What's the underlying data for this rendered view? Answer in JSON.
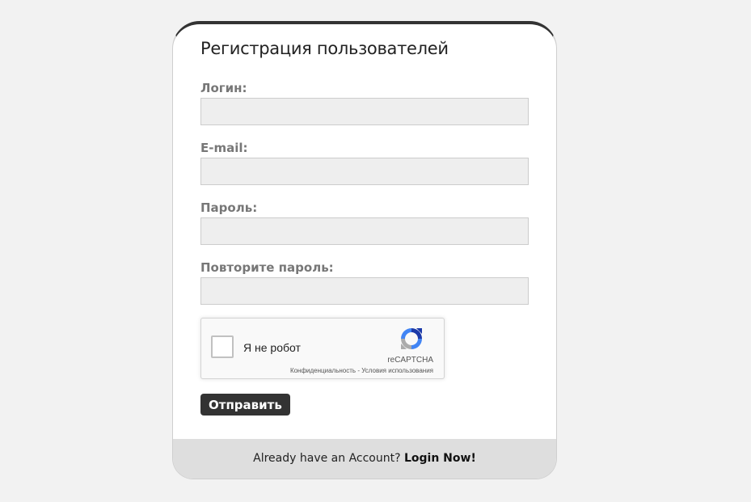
{
  "form": {
    "title": "Регистрация пользователей",
    "fields": [
      {
        "label": "Логин:",
        "value": "",
        "placeholder": ""
      },
      {
        "label": "E-mail:",
        "value": "",
        "placeholder": ""
      },
      {
        "label": "Пароль:",
        "value": "",
        "placeholder": ""
      },
      {
        "label": "Повторите пароль:",
        "value": "",
        "placeholder": ""
      }
    ],
    "captcha": {
      "label": "Я не робот",
      "brand": "reCAPTCHA",
      "privacy": "Конфиденциальность",
      "separator": " - ",
      "terms": "Условия использования",
      "checked": false
    },
    "submit_label": "Отправить"
  },
  "footer": {
    "text": "Already have an Account? ",
    "link": "Login Now!"
  },
  "colors": {
    "page_background": "#f2f2f2",
    "card_background": "#ffffff",
    "card_top_border": "#333333",
    "input_background": "#eeeeee",
    "button_background": "#333333",
    "footer_background": "#dedede",
    "label_color": "#777777"
  }
}
